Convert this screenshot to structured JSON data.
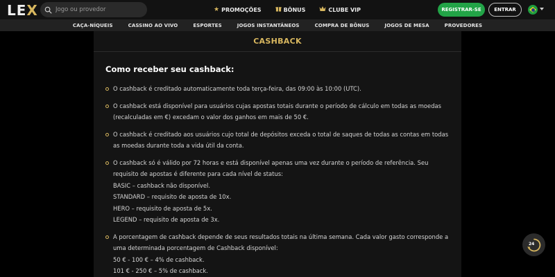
{
  "header": {
    "logo_text": "LE",
    "logo_x": "X",
    "search_placeholder": "Jogo ou provedor",
    "nav": [
      {
        "icon": "star-icon",
        "label": "PROMOÇÕES"
      },
      {
        "icon": "gift-icon",
        "label": "BÔNUS"
      },
      {
        "icon": "crown-icon",
        "label": "CLUBE VIP"
      }
    ],
    "register_label": "REGISTRAR-SE",
    "login_label": "ENTRAR",
    "language_flag": "brazil-flag-icon"
  },
  "categories": [
    "CAÇA-NÍQUEIS",
    "CASSINO AO VIVO",
    "ESPORTES",
    "JOGOS INSTANTÂNEOS",
    "COMPRA DE BÔNUS",
    "JOGOS DE MESA",
    "PROVEDORES"
  ],
  "panel": {
    "title": "CASHBACK",
    "section_title": "Como receber seu cashback:",
    "rules": [
      {
        "lines": [
          "O cashback é creditado automaticamente toda terça-feira, das 09:00 às 10:00 (UTC)."
        ]
      },
      {
        "lines": [
          "O cashback está disponível para usuários cujas apostas totais durante o período de cálculo em todas as moedas (recalculadas em €) excedam o valor dos ganhos em mais de 50 €."
        ]
      },
      {
        "lines": [
          "O cashback é creditado aos usuários cujo total de depósitos exceda o total de saques de todas as contas em todas as moedas durante toda a vida útil da conta."
        ]
      },
      {
        "lines": [
          "O cashback só é válido por 72 horas e está disponível apenas uma vez durante o período de referência. Seu requisito de apostas é diferente para cada nível de status:",
          "BASIC – cashback não disponível.",
          "STANDARD – requisito de aposta de 10x.",
          "HERO – requisito de aposta de 5x.",
          "LEGEND – requisito de aposta de 3x."
        ]
      },
      {
        "lines": [
          "A porcentagem de cashback depende de seus resultados totais na última semana. Cada valor gasto corresponde a uma determinada porcentagem de Cashback disponível:",
          "50 € - 100 € – 4% de cashback.",
          "101 € - 250 € – 5% de cashback."
        ]
      }
    ]
  },
  "support": {
    "icon": "support-24-icon",
    "badge": "24"
  },
  "colors": {
    "accent_gold": "#d8b75f",
    "register_green": "#22a447",
    "background": "#000000",
    "panel": "#141414"
  }
}
